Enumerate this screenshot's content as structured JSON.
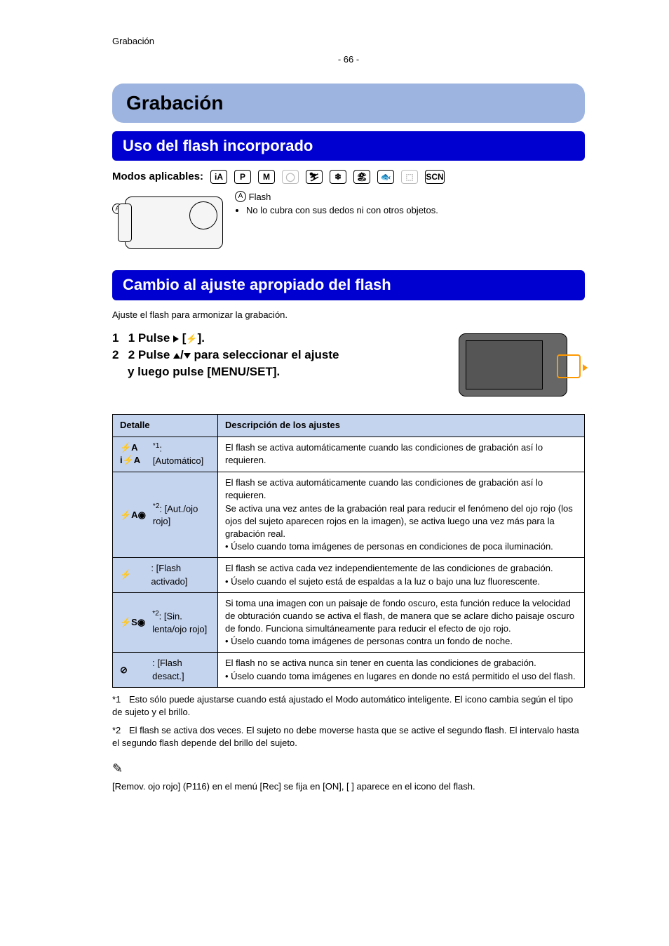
{
  "header": {
    "category": "Grabación",
    "page": "- 66 -"
  },
  "recording": {
    "title": "Grabación",
    "using_flash_title": "Uso del flash incorporado",
    "modes_label": "Modos aplicables:",
    "callout_a": "A",
    "flash_label": "Flash",
    "flash_note_bullet": "No lo cubra con sus dedos ni con otros objetos.",
    "switching_title": "Cambio al ajuste apropiado del flash",
    "instruction": "Ajuste el flash para armonizar la grabación.",
    "step1_a": "1 Pulse",
    "step1_b": "[",
    "step1_c": "].",
    "step2_a": "2 Pulse",
    "step2_b": "/",
    "step2_c": "para seleccionar el ajuste",
    "step2_d": "y luego pulse [MENU/SET].",
    "table": {
      "col1": "Detalle",
      "col2": "Descripción de los ajustes",
      "rows": [
        {
          "sup": "*1",
          "label": ": [Automático]",
          "desc": "El flash se activa automáticamente cuando las condiciones de grabación así lo requieren."
        },
        {
          "sup": "*2",
          "label": ": [Aut./ojo rojo]",
          "desc": "El flash se activa automáticamente cuando las condiciones de grabación así lo requieren.\nSe activa una vez antes de la grabación real para reducir el fenómeno del ojo rojo (los ojos del sujeto aparecen rojos en la imagen), se activa luego una vez más para la grabación real.\n• Úselo cuando toma imágenes de personas en condiciones de poca iluminación."
        },
        {
          "sup": "",
          "label": ": [Flash activado]",
          "desc": "El flash se activa cada vez independientemente de las condiciones de grabación.\n• Úselo cuando el sujeto está de espaldas a la luz o bajo una luz fluorescente."
        },
        {
          "sup": "*2",
          "label": ": [Sin. lenta/ojo rojo]",
          "desc": "Si toma una imagen con un paisaje de fondo oscuro, esta función reduce la velocidad de obturación cuando se activa el flash, de manera que se aclare dicho paisaje oscuro de fondo. Funciona simultáneamente para reducir el efecto de ojo rojo.\n• Úselo cuando toma imágenes de personas contra un fondo de noche."
        },
        {
          "sup": "",
          "label": ": [Flash desact.]",
          "desc": "El flash no se activa nunca sin tener en cuenta las condiciones de grabación.\n• Úselo cuando toma imágenes en lugares en donde no está permitido el uso del flash."
        }
      ]
    },
    "footnote1_mark": "*1",
    "footnote1": "Esto sólo puede ajustarse cuando está ajustado el Modo automático inteligente. El icono cambia según el tipo de sujeto y el brillo.",
    "footnote2_mark": "*2",
    "footnote2": "El flash se activa dos veces. El sujeto no debe moverse hasta que se active el segundo flash. El intervalo hasta el segundo flash depende del brillo del sujeto.",
    "footnote2b": "[Remov. ojo rojo] (P116) en el menú [Rec] se fija en [ON], [    ] aparece en el icono del flash."
  }
}
